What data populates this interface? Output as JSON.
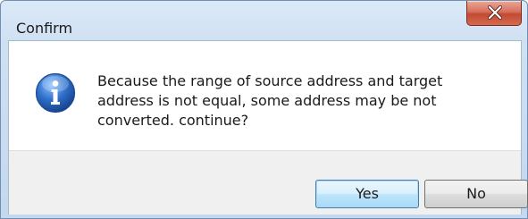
{
  "window": {
    "title": "Confirm",
    "close_icon": "close-icon"
  },
  "message": {
    "icon": "info-icon",
    "text": "Because the range of source address and target address is not equal, some address may be not converted. continue?"
  },
  "buttons": {
    "yes_label": "Yes",
    "no_label": "No"
  },
  "colors": {
    "close_button": "#c34a32",
    "info_icon": "#2f6fc9",
    "default_button_border": "#3c7fb1"
  }
}
